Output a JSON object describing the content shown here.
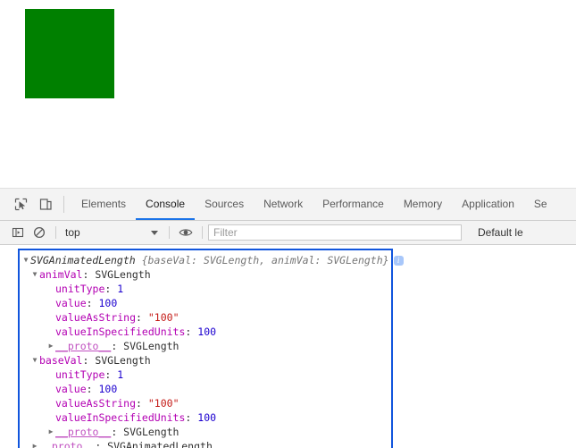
{
  "page": {
    "rect": {
      "name": "green-square",
      "fill": "#008000",
      "width": "100",
      "height": "100"
    }
  },
  "devtools": {
    "toolbar": {
      "inspect_icon": "inspect-cursor-icon",
      "device_icon": "device-toolbar-icon",
      "tabs": [
        {
          "label": "Elements",
          "active": false
        },
        {
          "label": "Console",
          "active": true
        },
        {
          "label": "Sources",
          "active": false
        },
        {
          "label": "Network",
          "active": false
        },
        {
          "label": "Performance",
          "active": false
        },
        {
          "label": "Memory",
          "active": false
        },
        {
          "label": "Application",
          "active": false
        },
        {
          "label": "Se",
          "active": false
        }
      ],
      "active_tab_color": "#1a73e8"
    },
    "filterbar": {
      "sidebar_icon": "show-console-sidebar-icon",
      "clear_icon": "clear-console-icon",
      "context_label": "top",
      "eye_icon": "live-expression-icon",
      "filter_placeholder": "Filter",
      "filter_value": "",
      "level_label": "Default le"
    },
    "console": {
      "border_color": "#1155dd",
      "entries": [
        {
          "id": "root",
          "indent": 0,
          "expanded": true,
          "header_name": "SVGAnimatedLength",
          "header_preview": "{baseVal: SVGLength, animVal: SVGLength}",
          "badge": "i"
        },
        {
          "id": "animVal",
          "indent": 1,
          "expanded": true,
          "prop": "animVal",
          "sep": ": ",
          "value": "SVGLength",
          "value_type": "class"
        },
        {
          "id": "animVal-unitType",
          "indent": 2,
          "expanded": null,
          "prop": "unitType",
          "sep": ": ",
          "value": "1",
          "value_type": "number"
        },
        {
          "id": "animVal-value",
          "indent": 2,
          "expanded": null,
          "prop": "value",
          "sep": ": ",
          "value": "100",
          "value_type": "number"
        },
        {
          "id": "animVal-valueAsString",
          "indent": 2,
          "expanded": null,
          "prop": "valueAsString",
          "sep": ": ",
          "value": "\"100\"",
          "value_type": "string"
        },
        {
          "id": "animVal-valueInSpecifiedUnits",
          "indent": 2,
          "expanded": null,
          "prop": "valueInSpecifiedUnits",
          "sep": ": ",
          "value": "100",
          "value_type": "number"
        },
        {
          "id": "animVal-proto",
          "indent": 2,
          "expanded": false,
          "prop": "__proto__",
          "sep": ": ",
          "value": "SVGLength",
          "value_type": "proto"
        },
        {
          "id": "baseVal",
          "indent": 1,
          "expanded": true,
          "prop": "baseVal",
          "sep": ": ",
          "value": "SVGLength",
          "value_type": "class"
        },
        {
          "id": "baseVal-unitType",
          "indent": 2,
          "expanded": null,
          "prop": "unitType",
          "sep": ": ",
          "value": "1",
          "value_type": "number"
        },
        {
          "id": "baseVal-value",
          "indent": 2,
          "expanded": null,
          "prop": "value",
          "sep": ": ",
          "value": "100",
          "value_type": "number"
        },
        {
          "id": "baseVal-valueAsString",
          "indent": 2,
          "expanded": null,
          "prop": "valueAsString",
          "sep": ": ",
          "value": "\"100\"",
          "value_type": "string"
        },
        {
          "id": "baseVal-valueInSpecifiedUnits",
          "indent": 2,
          "expanded": null,
          "prop": "valueInSpecifiedUnits",
          "sep": ": ",
          "value": "100",
          "value_type": "number"
        },
        {
          "id": "baseVal-proto",
          "indent": 2,
          "expanded": false,
          "prop": "__proto__",
          "sep": ": ",
          "value": "SVGLength",
          "value_type": "proto"
        },
        {
          "id": "root-proto",
          "indent": 1,
          "expanded": false,
          "prop": "__proto__",
          "sep": ": ",
          "value": "SVGAnimatedLength",
          "value_type": "proto"
        }
      ]
    }
  }
}
